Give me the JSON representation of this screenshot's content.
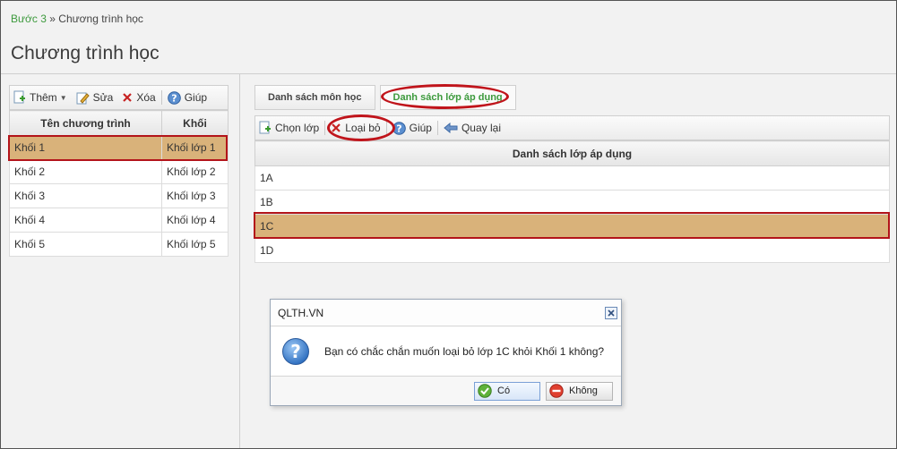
{
  "breadcrumb": {
    "link": "Bước 3",
    "separator": "»",
    "current": "Chương trình học"
  },
  "page_title": "Chương trình học",
  "left_toolbar": {
    "add": "Thêm",
    "edit": "Sửa",
    "delete": "Xóa",
    "help": "Giúp"
  },
  "left_table": {
    "headers": [
      "Tên chương trình",
      "Khối"
    ],
    "rows": [
      [
        "Khối 1",
        "Khối lớp 1"
      ],
      [
        "Khối 2",
        "Khối lớp 2"
      ],
      [
        "Khối 3",
        "Khối lớp 3"
      ],
      [
        "Khối 4",
        "Khối lớp 4"
      ],
      [
        "Khối 5",
        "Khối lớp 5"
      ]
    ],
    "selected_index": 0
  },
  "tabs": [
    "Danh sách môn học",
    "Danh sách lớp áp dụng"
  ],
  "active_tab": 1,
  "right_toolbar": {
    "choose": "Chọn lớp",
    "remove": "Loại bỏ",
    "help": "Giúp",
    "back": "Quay lại"
  },
  "right_table": {
    "header": "Danh sách lớp áp dụng",
    "rows": [
      "1A",
      "1B",
      "1C",
      "1D"
    ],
    "selected_index": 2
  },
  "dialog": {
    "title": "QLTH.VN",
    "message": "Bạn có chắc chắn muốn loại bỏ lớp 1C khỏi Khối 1 không?",
    "yes": "Có",
    "no": "Không"
  },
  "colors": {
    "accent_green": "#3d9a3d",
    "selection": "#d9b27a",
    "annotation_red": "#c0141b"
  }
}
